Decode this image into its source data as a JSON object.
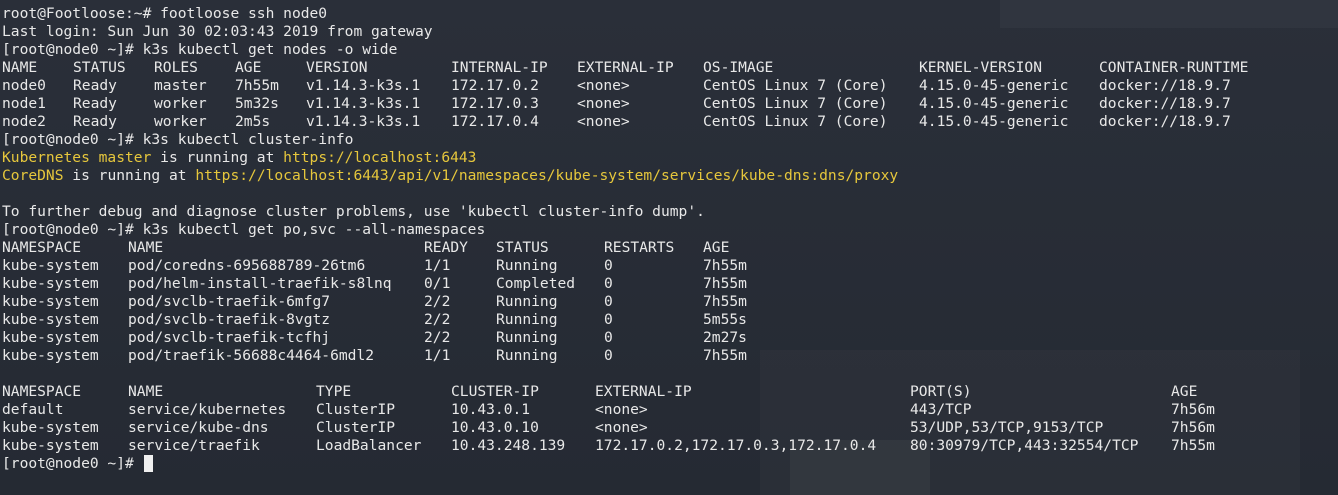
{
  "session": [
    "root@Footloose:~# footloose ssh node0",
    "Last login: Sun Jun 30 02:03:43 2019 from gateway",
    "[root@node0 ~]# k3s kubectl get nodes -o wide"
  ],
  "nodes_table": {
    "headers": [
      "NAME",
      "STATUS",
      "ROLES",
      "AGE",
      "VERSION",
      "INTERNAL-IP",
      "EXTERNAL-IP",
      "OS-IMAGE",
      "KERNEL-VERSION",
      "CONTAINER-RUNTIME"
    ],
    "rows": [
      [
        "node0",
        "Ready",
        "master",
        "7h55m",
        "v1.14.3-k3s.1",
        "172.17.0.2",
        "<none>",
        "CentOS Linux 7 (Core)",
        "4.15.0-45-generic",
        "docker://18.9.7"
      ],
      [
        "node1",
        "Ready",
        "worker",
        "5m32s",
        "v1.14.3-k3s.1",
        "172.17.0.3",
        "<none>",
        "CentOS Linux 7 (Core)",
        "4.15.0-45-generic",
        "docker://18.9.7"
      ],
      [
        "node2",
        "Ready",
        "worker",
        "2m5s",
        "v1.14.3-k3s.1",
        "172.17.0.4",
        "<none>",
        "CentOS Linux 7 (Core)",
        "4.15.0-45-generic",
        "docker://18.9.7"
      ]
    ]
  },
  "cluster_info": {
    "command": "[root@node0 ~]# k3s kubectl cluster-info",
    "master_label": "Kubernetes master",
    "master_mid": " is running at ",
    "master_url": "https://localhost:6443",
    "dns_label": "CoreDNS",
    "dns_mid": " is running at ",
    "dns_url": "https://localhost:6443/api/v1/namespaces/kube-system/services/kube-dns:dns/proxy",
    "hint": "To further debug and diagnose cluster problems, use 'kubectl cluster-info dump'."
  },
  "pods_command": "[root@node0 ~]# k3s kubectl get po,svc --all-namespaces",
  "pods_table": {
    "headers": [
      "NAMESPACE",
      "NAME",
      "READY",
      "STATUS",
      "RESTARTS",
      "AGE"
    ],
    "rows": [
      [
        "kube-system",
        "pod/coredns-695688789-26tm6",
        "1/1",
        "Running",
        "0",
        "7h55m"
      ],
      [
        "kube-system",
        "pod/helm-install-traefik-s8lnq",
        "0/1",
        "Completed",
        "0",
        "7h55m"
      ],
      [
        "kube-system",
        "pod/svclb-traefik-6mfg7",
        "2/2",
        "Running",
        "0",
        "7h55m"
      ],
      [
        "kube-system",
        "pod/svclb-traefik-8vgtz",
        "2/2",
        "Running",
        "0",
        "5m55s"
      ],
      [
        "kube-system",
        "pod/svclb-traefik-tcfhj",
        "2/2",
        "Running",
        "0",
        "2m27s"
      ],
      [
        "kube-system",
        "pod/traefik-56688c4464-6mdl2",
        "1/1",
        "Running",
        "0",
        "7h55m"
      ]
    ]
  },
  "svc_table": {
    "headers": [
      "NAMESPACE",
      "NAME",
      "TYPE",
      "CLUSTER-IP",
      "EXTERNAL-IP",
      "PORT(S)",
      "AGE"
    ],
    "rows": [
      [
        "default",
        "service/kubernetes",
        "ClusterIP",
        "10.43.0.1",
        "<none>",
        "443/TCP",
        "7h56m"
      ],
      [
        "kube-system",
        "service/kube-dns",
        "ClusterIP",
        "10.43.0.10",
        "<none>",
        "53/UDP,53/TCP,9153/TCP",
        "7h56m"
      ],
      [
        "kube-system",
        "service/traefik",
        "LoadBalancer",
        "10.43.248.139",
        "172.17.0.2,172.17.0.3,172.17.0.4",
        "80:30979/TCP,443:32554/TCP",
        "7h55m"
      ]
    ]
  },
  "prompt": "[root@node0 ~]# ",
  "colors": {
    "background": "#262b35",
    "foreground": "#e8e8e8",
    "highlight": "#e6c73c"
  }
}
